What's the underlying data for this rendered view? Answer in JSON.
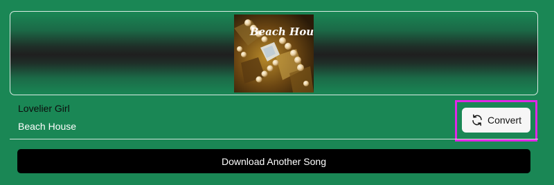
{
  "track": {
    "title": "Lovelier Girl",
    "artist": "Beach House",
    "album_art_text": "Beach House"
  },
  "actions": {
    "convert_label": "Convert",
    "convert_icon": "refresh-icon",
    "download_another_label": "Download Another Song"
  },
  "colors": {
    "background": "#1a8755",
    "highlight": "#e028e6",
    "download_button": "#000000",
    "convert_button": "#f6f6f6"
  }
}
